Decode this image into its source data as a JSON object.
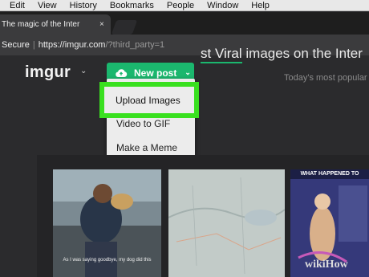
{
  "menubar": {
    "items": [
      "Edit",
      "View",
      "History",
      "Bookmarks",
      "People",
      "Window",
      "Help"
    ]
  },
  "browser": {
    "tab_title": "The magic of the Inter",
    "tab_close": "×",
    "address": {
      "secure_label": "Secure",
      "separator": "|",
      "url_host": "https://imgur.com",
      "url_rest": "/?third_party=1"
    }
  },
  "site": {
    "logo": "imgur",
    "logo_chevron": "⌄",
    "new_post_label": "New post",
    "new_post_chevron": "⌄",
    "headline_prefix": "st Viral",
    "headline_suffix": " images on the Inter",
    "subtitle": "Today's most popular"
  },
  "dropdown": {
    "items": [
      "Upload Images",
      "Video to GIF",
      "Make a Meme"
    ],
    "highlighted_color": "#39e01f"
  },
  "gallery": {
    "captions": [
      "As I was saying goodbye, my dog did this",
      "WHAT HAPPENED TO"
    ]
  },
  "watermark": "wikiHow",
  "colors": {
    "accent": "#1bb76e",
    "background": "#2b2b2d"
  }
}
